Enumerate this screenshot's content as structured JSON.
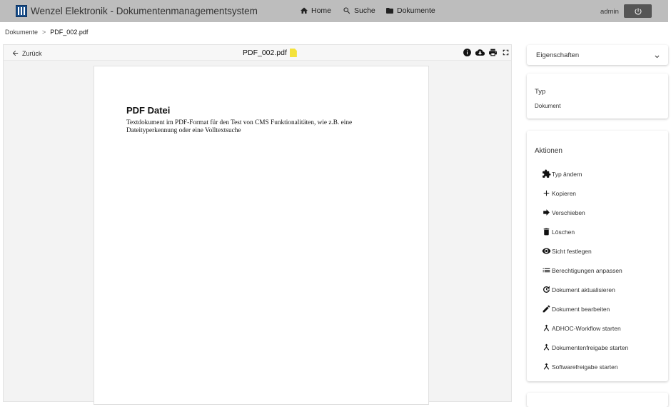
{
  "header": {
    "app_title": "Wenzel Elektronik - Dokumentenmanagementsystem",
    "nav": [
      {
        "label": "Home",
        "icon": "home-icon"
      },
      {
        "label": "Suche",
        "icon": "search-icon"
      },
      {
        "label": "Dokumente",
        "icon": "folder-icon"
      }
    ],
    "user": "admin",
    "power_icon": "power-icon"
  },
  "breadcrumb": {
    "parent": "Dokumente",
    "separator": ">",
    "current": "PDF_002.pdf"
  },
  "viewer": {
    "back_label": "Zurück",
    "file_name": "PDF_002.pdf",
    "file_icon_color": "#f4e23b",
    "tool_icons": [
      "info-icon",
      "cloud-download-icon",
      "print-icon",
      "fullscreen-icon"
    ],
    "document": {
      "heading": "PDF Datei",
      "body": "Textdokument im PDF-Format für den Test von CMS Funktionalitäten, wie z.B. eine Dateityperkennung oder eine Volltextsuche"
    }
  },
  "sidebar": {
    "properties_title": "Eigenschaften",
    "type_label": "Typ",
    "type_value": "Dokument",
    "actions_title": "Aktionen",
    "actions": [
      {
        "label": "Typ ändern",
        "icon": "puzzle-icon"
      },
      {
        "label": "Kopieren",
        "icon": "plus-icon"
      },
      {
        "label": "Verschieben",
        "icon": "arrow-right-icon"
      },
      {
        "label": "Löschen",
        "icon": "trash-icon"
      },
      {
        "label": "Sicht festlegen",
        "icon": "eye-icon"
      },
      {
        "label": "Berechtigungen anpassen",
        "icon": "list-icon"
      },
      {
        "label": "Dokument aktualisieren",
        "icon": "refresh-icon"
      },
      {
        "label": "Dokument bearbeiten",
        "icon": "pencil-icon"
      },
      {
        "label": "ADHOC-Workflow starten",
        "icon": "merge-icon"
      },
      {
        "label": "Dokumentenfreigabe starten",
        "icon": "merge-icon"
      },
      {
        "label": "Softwarefreigabe starten",
        "icon": "merge-icon"
      }
    ]
  },
  "colors": {
    "topbar": "#bdbdbd",
    "power_button": "#555555",
    "viewer_bg": "#f3f3f3"
  }
}
